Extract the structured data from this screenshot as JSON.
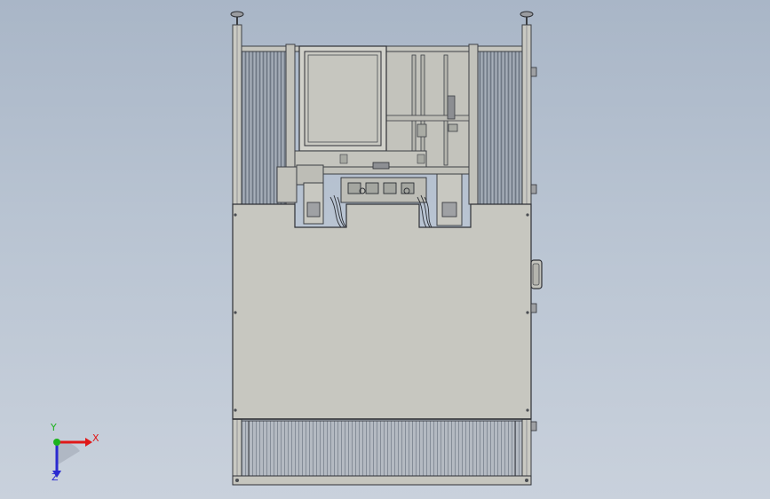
{
  "viewport": {
    "background_top": "#a9b6c7",
    "background_bottom": "#c9d1dc"
  },
  "model": {
    "name": "machine-assembly-front-view",
    "frame_color": "#c4c4bc",
    "panel_color": "#c7c7c0",
    "guard_color": "#8d96a2"
  },
  "triad": {
    "x_label": "X",
    "y_label": "Y",
    "z_label": "Z",
    "x_color": "#e01818",
    "y_color": "#1db31d",
    "z_color": "#2a2ad0"
  }
}
